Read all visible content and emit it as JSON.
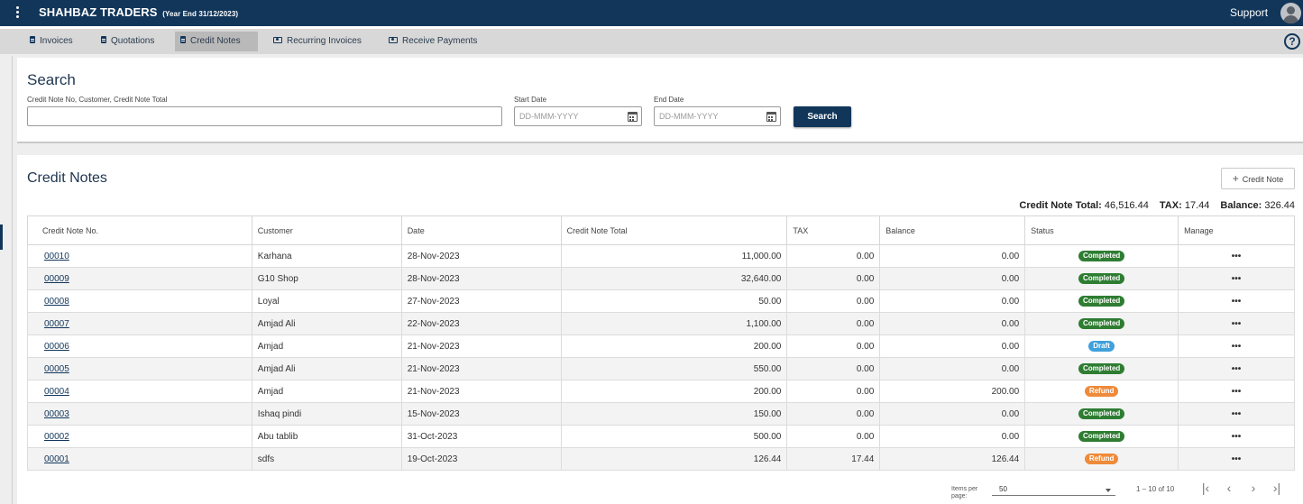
{
  "app": {
    "company": "SHAHBAZ TRADERS",
    "year_end": "(Year End 31/12/2023)",
    "support": "Support",
    "help": "?"
  },
  "tabs": [
    {
      "label": "Invoices",
      "icon": "document-icon"
    },
    {
      "label": "Quotations",
      "icon": "document-icon"
    },
    {
      "label": "Credit Notes",
      "icon": "document-icon",
      "active": true
    },
    {
      "label": "Recurring Invoices",
      "icon": "cash-icon"
    },
    {
      "label": "Receive Payments",
      "icon": "cash-icon"
    }
  ],
  "search": {
    "title": "Search",
    "query_label": "Credit Note No, Customer, Credit Note Total",
    "query_value": "",
    "start_label": "Start Date",
    "start_placeholder": "DD-MMM-YYYY",
    "end_label": "End Date",
    "end_placeholder": "DD-MMM-YYYY",
    "button": "Search"
  },
  "credit_notes": {
    "title": "Credit Notes",
    "add_button": "Credit Note",
    "totals": {
      "total_label": "Credit Note Total:",
      "total_value": "46,516.44",
      "tax_label": "TAX:",
      "tax_value": "17.44",
      "balance_label": "Balance:",
      "balance_value": "326.44"
    },
    "columns": [
      "Credit Note No.",
      "Customer",
      "Date",
      "Credit Note Total",
      "TAX",
      "Balance",
      "Status",
      "Manage"
    ],
    "rows": [
      {
        "no": "00010",
        "customer": "Karhana",
        "date": "28-Nov-2023",
        "total": "11,000.00",
        "tax": "0.00",
        "balance": "0.00",
        "status": "Completed"
      },
      {
        "no": "00009",
        "customer": "G10 Shop",
        "date": "28-Nov-2023",
        "total": "32,640.00",
        "tax": "0.00",
        "balance": "0.00",
        "status": "Completed"
      },
      {
        "no": "00008",
        "customer": "Loyal",
        "date": "27-Nov-2023",
        "total": "50.00",
        "tax": "0.00",
        "balance": "0.00",
        "status": "Completed"
      },
      {
        "no": "00007",
        "customer": "Amjad Ali",
        "date": "22-Nov-2023",
        "total": "1,100.00",
        "tax": "0.00",
        "balance": "0.00",
        "status": "Completed"
      },
      {
        "no": "00006",
        "customer": "Amjad",
        "date": "21-Nov-2023",
        "total": "200.00",
        "tax": "0.00",
        "balance": "0.00",
        "status": "Draft"
      },
      {
        "no": "00005",
        "customer": "Amjad Ali",
        "date": "21-Nov-2023",
        "total": "550.00",
        "tax": "0.00",
        "balance": "0.00",
        "status": "Completed"
      },
      {
        "no": "00004",
        "customer": "Amjad",
        "date": "21-Nov-2023",
        "total": "200.00",
        "tax": "0.00",
        "balance": "200.00",
        "status": "Refund"
      },
      {
        "no": "00003",
        "customer": "Ishaq pindi",
        "date": "15-Nov-2023",
        "total": "150.00",
        "tax": "0.00",
        "balance": "0.00",
        "status": "Completed"
      },
      {
        "no": "00002",
        "customer": "Abu tablib",
        "date": "31-Oct-2023",
        "total": "500.00",
        "tax": "0.00",
        "balance": "0.00",
        "status": "Completed"
      },
      {
        "no": "00001",
        "customer": "sdfs",
        "date": "19-Oct-2023",
        "total": "126.44",
        "tax": "17.44",
        "balance": "126.44",
        "status": "Refund"
      }
    ],
    "manage_glyph": "•••"
  },
  "pagination": {
    "items_per_page_label": "Items per page:",
    "items_per_page": "50",
    "range": "1 – 10 of 10",
    "first": "|‹",
    "prev": "‹",
    "next": "›",
    "last": "›|"
  },
  "colors": {
    "primary": "#12365a",
    "completed": "#2e7d32",
    "draft": "#3fa0dc",
    "refund": "#ee8a3a"
  }
}
